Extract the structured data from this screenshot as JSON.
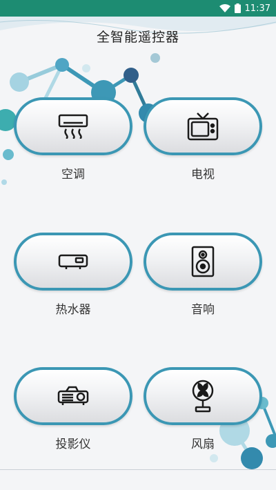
{
  "status_bar": {
    "time": "11:37",
    "icons": [
      "wifi-icon",
      "battery-icon"
    ]
  },
  "header": {
    "title": "全智能遥控器"
  },
  "devices": [
    {
      "label": "空调",
      "icon": "air-conditioner-icon"
    },
    {
      "label": "电视",
      "icon": "tv-icon"
    },
    {
      "label": "热水器",
      "icon": "water-heater-icon"
    },
    {
      "label": "音响",
      "icon": "speaker-icon"
    },
    {
      "label": "投影仪",
      "icon": "projector-icon"
    },
    {
      "label": "风扇",
      "icon": "fan-icon"
    }
  ],
  "colors": {
    "status_bar": "#1d8c72",
    "tile_border": "#3b97b4",
    "accent_molecule": "#2a8fb0"
  }
}
